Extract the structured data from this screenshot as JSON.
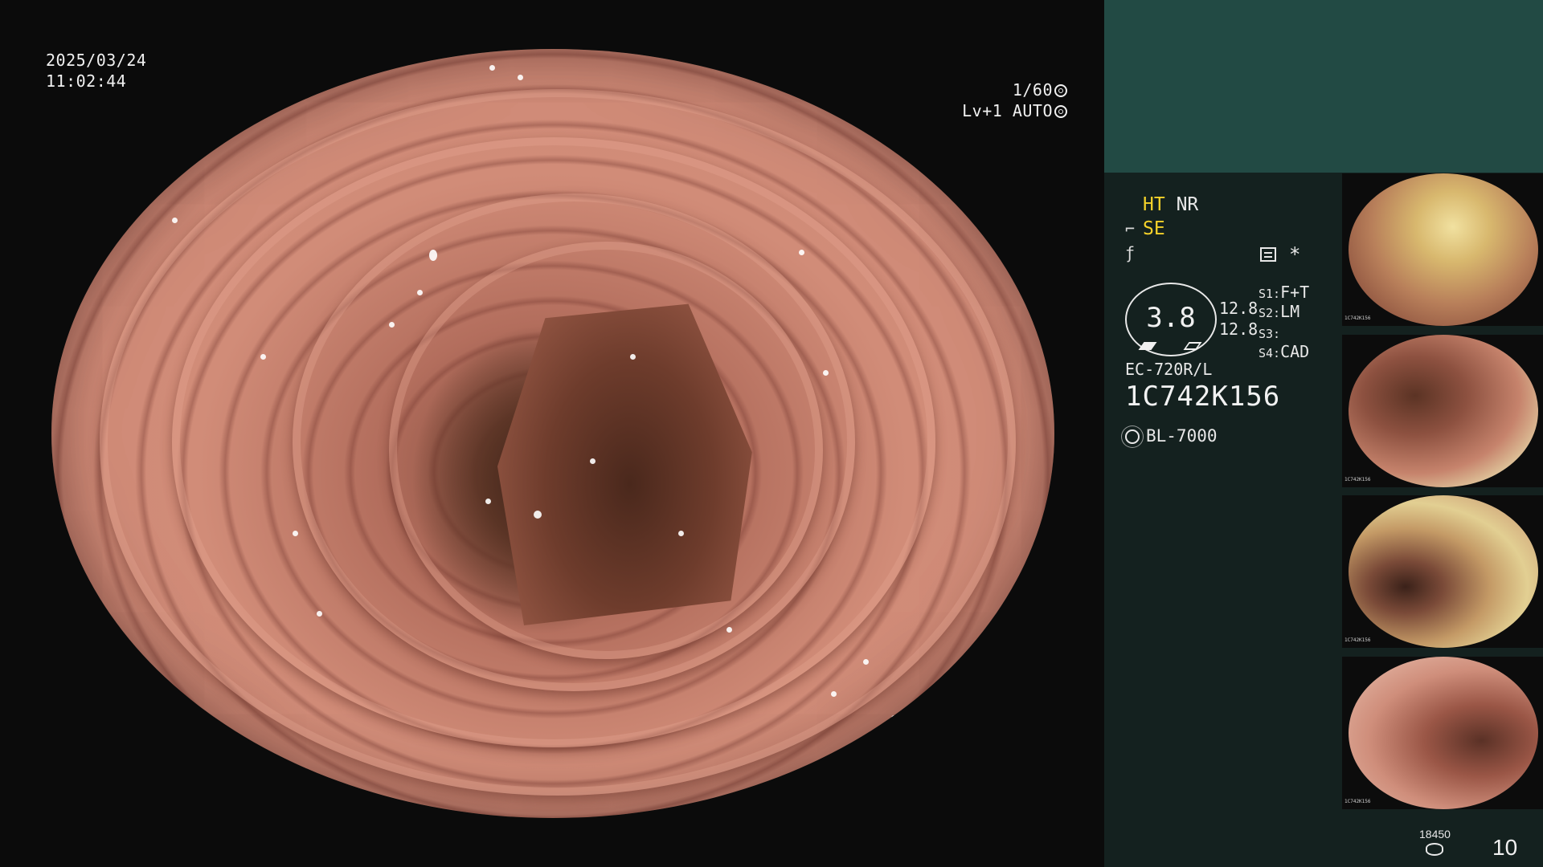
{
  "overlay": {
    "date": "2025/03/24",
    "time": "11:02:44",
    "shutter": "1/60",
    "level_mode": "Lv+1 AUTO"
  },
  "panel": {
    "mode_1": "HT",
    "mode_2": "NR",
    "mode_3": "SE",
    "vital_value": "3.8",
    "num_1": "12.8",
    "num_2": "12.8",
    "s1_label": "S1:",
    "s1_value": "F+T",
    "s2_label": "S2:",
    "s2_value": "LM",
    "s3_label": "S3:",
    "s3_value": "",
    "s4_label": "S4:",
    "s4_value": "CAD",
    "scope_model": "EC-720R/L",
    "scope_serial": "1C742K156",
    "light_source": "BL-7000",
    "storage_count": "18450",
    "page_count": "10"
  },
  "thumbnails": [
    {
      "caption": "1C742K156"
    },
    {
      "caption": "1C742K156"
    },
    {
      "caption": "1C742K156"
    },
    {
      "caption": "1C742K156"
    }
  ],
  "colors": {
    "panel_top": "#224a44",
    "panel_bg": "#14211f",
    "highlight_yellow": "#f5d22a"
  },
  "icons": [
    "shutter-icon",
    "auto-light-icon",
    "scope-angle-icon",
    "freeze-icon",
    "settings-icon",
    "asterisk-icon",
    "light-source-icon",
    "storage-icon"
  ]
}
